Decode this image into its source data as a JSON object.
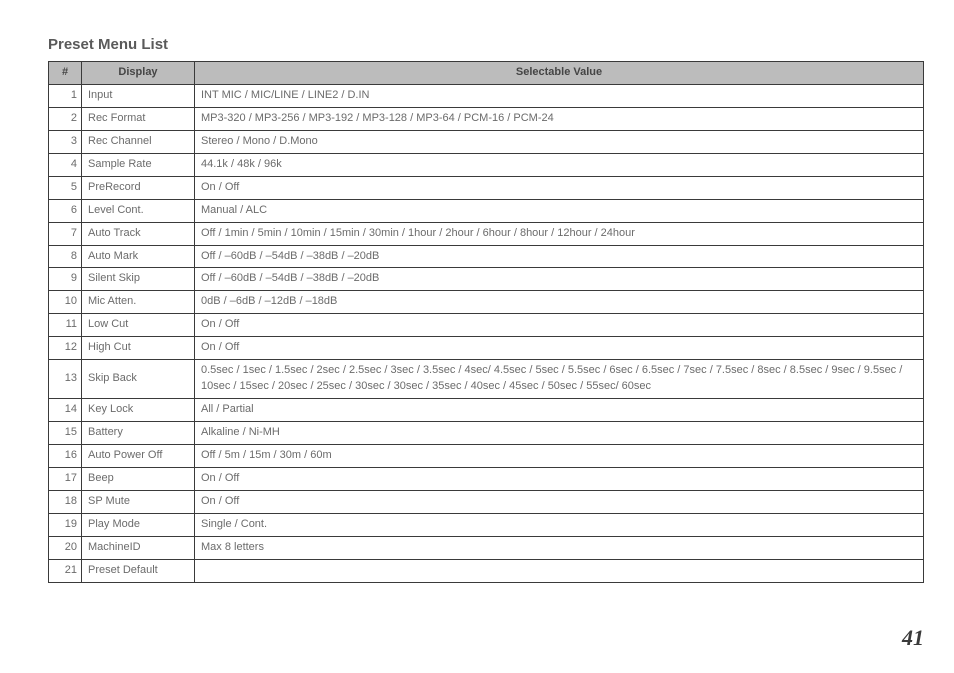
{
  "title": "Preset Menu List",
  "page_number": "41",
  "headers": {
    "num": "#",
    "display": "Display",
    "value": "Selectable Value"
  },
  "rows": [
    {
      "n": "1",
      "d": "Input",
      "v": "INT MIC / MIC/LINE / LINE2 / D.IN"
    },
    {
      "n": "2",
      "d": "Rec Format",
      "v": "MP3-320 / MP3-256 / MP3-192 / MP3-128 / MP3-64 / PCM-16 / PCM-24"
    },
    {
      "n": "3",
      "d": "Rec Channel",
      "v": "Stereo / Mono / D.Mono"
    },
    {
      "n": "4",
      "d": "Sample Rate",
      "v": "44.1k / 48k / 96k"
    },
    {
      "n": "5",
      "d": "PreRecord",
      "v": "On / Off"
    },
    {
      "n": "6",
      "d": "Level Cont.",
      "v": "Manual / ALC"
    },
    {
      "n": "7",
      "d": "Auto Track",
      "v": "Off / 1min / 5min / 10min / 15min / 30min / 1hour / 2hour / 6hour / 8hour / 12hour / 24hour"
    },
    {
      "n": "8",
      "d": "Auto Mark",
      "v": "Off / –60dB / –54dB / –38dB / –20dB"
    },
    {
      "n": "9",
      "d": "Silent Skip",
      "v": "Off / –60dB / –54dB / –38dB / –20dB"
    },
    {
      "n": "10",
      "d": "Mic Atten.",
      "v": "0dB / –6dB / –12dB / –18dB"
    },
    {
      "n": "11",
      "d": "Low Cut",
      "v": "On / Off"
    },
    {
      "n": "12",
      "d": "High Cut",
      "v": "On / Off"
    },
    {
      "n": "13",
      "d": "Skip Back",
      "v": "0.5sec / 1sec / 1.5sec / 2sec / 2.5sec / 3sec / 3.5sec / 4sec/ 4.5sec / 5sec / 5.5sec / 6sec / 6.5sec / 7sec / 7.5sec / 8sec / 8.5sec / 9sec / 9.5sec / 10sec / 15sec / 20sec / 25sec / 30sec / 30sec / 35sec / 40sec / 45sec / 50sec / 55sec/ 60sec"
    },
    {
      "n": "14",
      "d": "Key Lock",
      "v": "All / Partial"
    },
    {
      "n": "15",
      "d": "Battery",
      "v": "Alkaline / Ni-MH"
    },
    {
      "n": "16",
      "d": "Auto Power Off",
      "v": "Off / 5m / 15m / 30m / 60m"
    },
    {
      "n": "17",
      "d": "Beep",
      "v": "On / Off"
    },
    {
      "n": "18",
      "d": "SP Mute",
      "v": "On / Off"
    },
    {
      "n": "19",
      "d": "Play Mode",
      "v": "Single / Cont."
    },
    {
      "n": "20",
      "d": "MachineID",
      "v": "Max 8 letters"
    },
    {
      "n": "21",
      "d": "Preset Default",
      "v": ""
    }
  ]
}
